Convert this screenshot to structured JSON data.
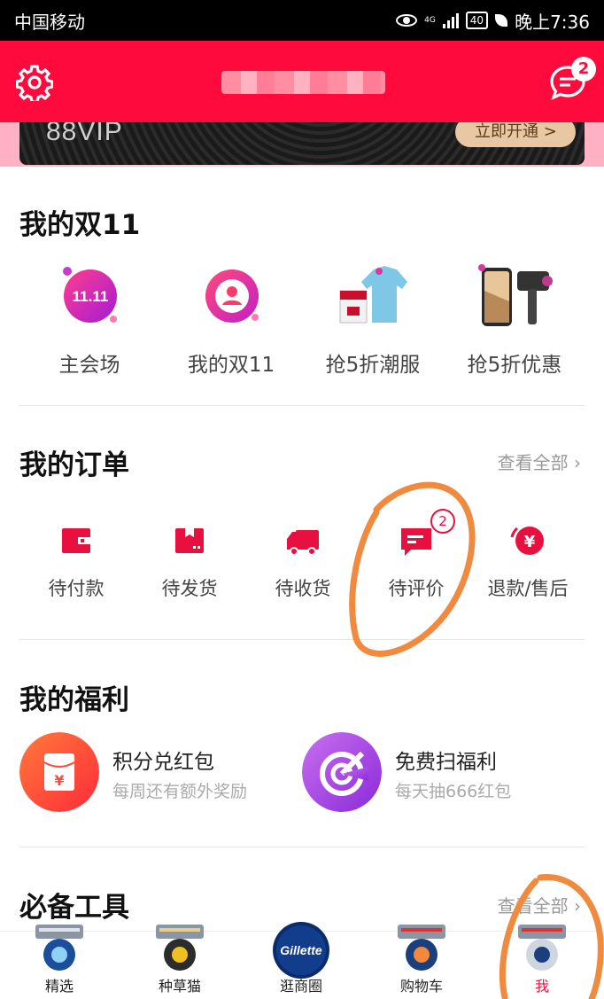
{
  "status_bar": {
    "carrier": "中国移动",
    "network": "4G",
    "battery": "40",
    "time": "晚上7:36"
  },
  "header": {
    "settings_icon": "gear-icon",
    "message_icon": "message-icon",
    "message_badge": "2",
    "username": ""
  },
  "vip_banner": {
    "text": "88VIP",
    "button": "立即开通 >"
  },
  "double11": {
    "title": "我的双11",
    "items": [
      {
        "label": "主会场",
        "icon": "11.11"
      },
      {
        "label": "我的双11",
        "icon": "avatar-icon"
      },
      {
        "label": "抢5折潮服",
        "icon": "clothes-icon"
      },
      {
        "label": "抢5折优惠",
        "icon": "phone-hairdryer-icon"
      }
    ]
  },
  "orders": {
    "title": "我的订单",
    "view_all": "查看全部",
    "items": [
      {
        "label": "待付款",
        "icon": "wallet-icon"
      },
      {
        "label": "待发货",
        "icon": "package-icon"
      },
      {
        "label": "待收货",
        "icon": "truck-icon"
      },
      {
        "label": "待评价",
        "icon": "comment-icon",
        "badge": "2"
      },
      {
        "label": "退款/售后",
        "icon": "refund-icon"
      }
    ]
  },
  "welfare": {
    "title": "我的福利",
    "items": [
      {
        "title": "积分兑红包",
        "subtitle": "每周还有额外奖励",
        "icon": "red-envelope-icon",
        "color": "#ff5a2a"
      },
      {
        "title": "免费扫福利",
        "subtitle": "每天抽666红包",
        "icon": "scan-icon",
        "color": "#a845e8"
      }
    ]
  },
  "tools": {
    "title": "必备工具",
    "view_all": "查看全部"
  },
  "tabbar": {
    "items": [
      {
        "label": "精选"
      },
      {
        "label": "种草猫"
      },
      {
        "label": "逛商圈",
        "logo_text": "Gillette"
      },
      {
        "label": "购物车"
      },
      {
        "label": "我",
        "active": true
      }
    ]
  },
  "colors": {
    "brand": "#ff0a3c",
    "annotation": "#f08a3e"
  }
}
